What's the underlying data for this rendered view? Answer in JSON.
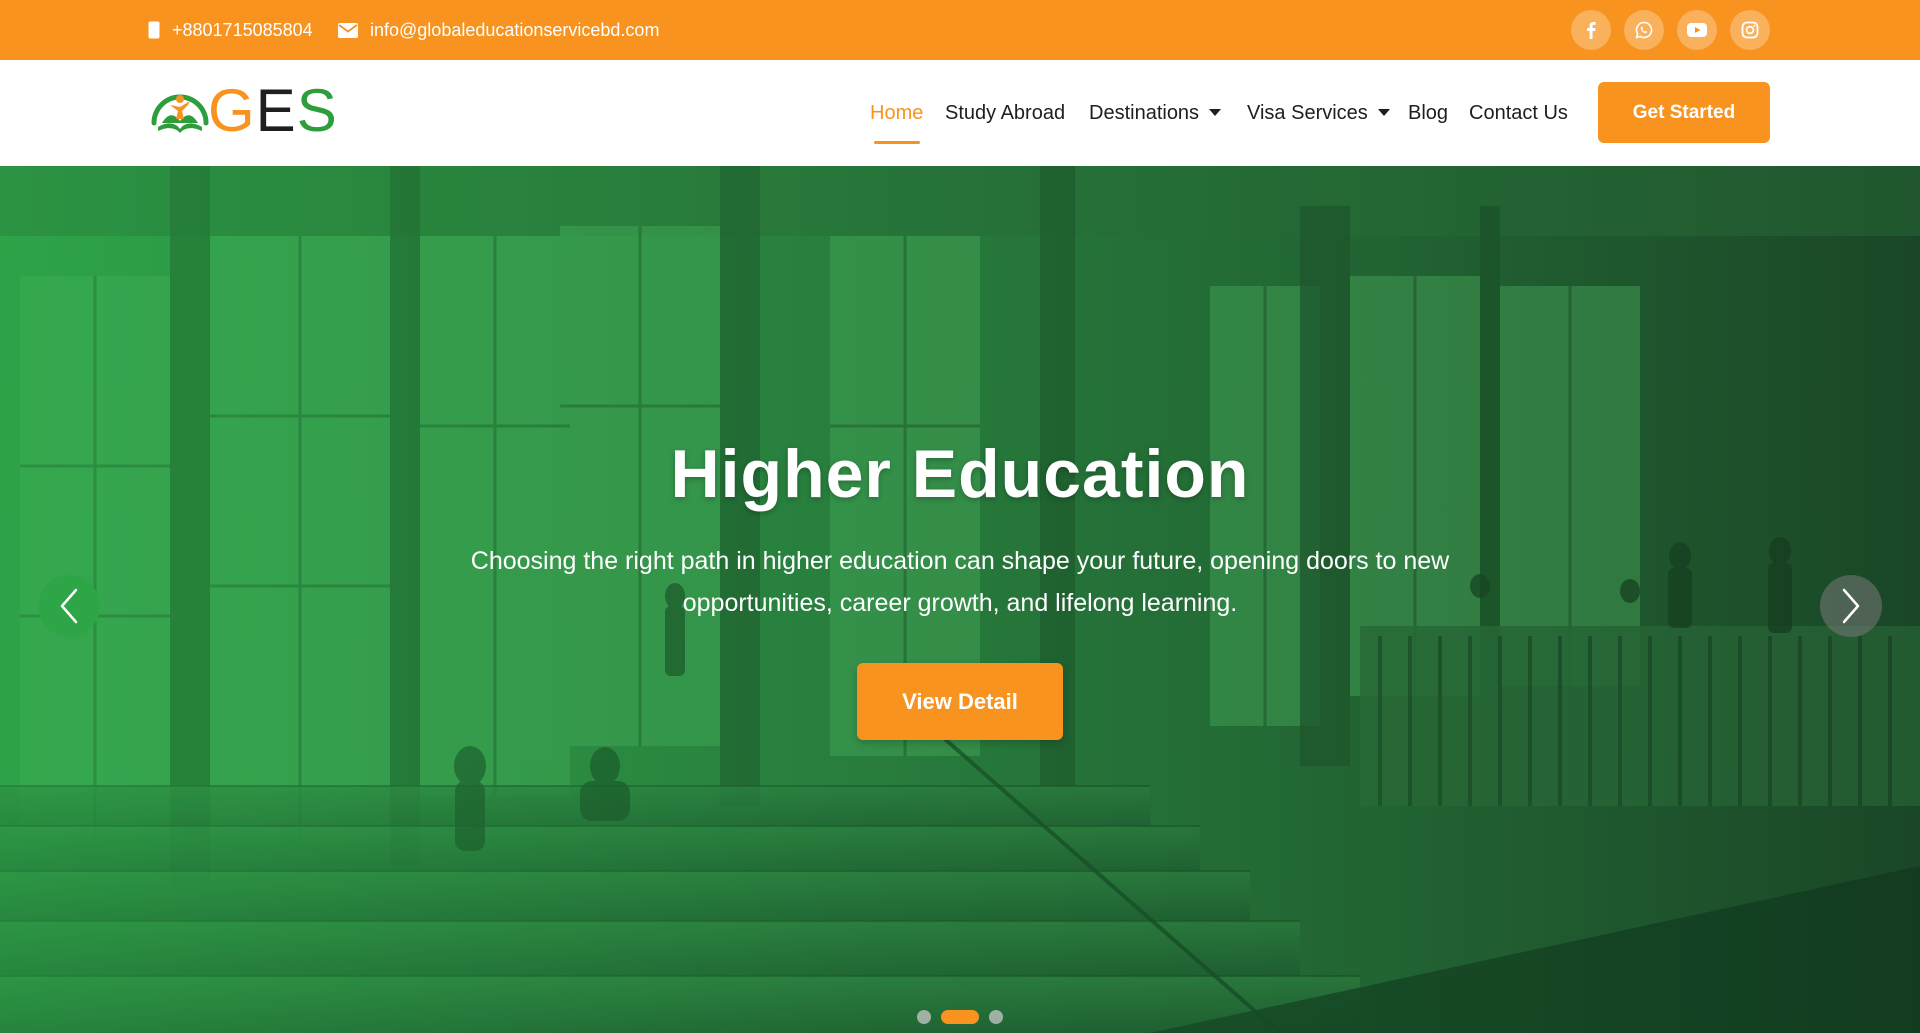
{
  "topbar": {
    "phone": "+8801715085804",
    "email": "info@globaleducationservicebd.com",
    "phone_icon": "mobile-phone-icon",
    "email_icon": "envelope-icon",
    "socials": [
      "facebook-icon",
      "whatsapp-icon",
      "youtube-icon",
      "instagram-icon"
    ]
  },
  "logo": {
    "letters": [
      "G",
      "E",
      "S"
    ]
  },
  "nav": {
    "items": [
      {
        "label": "Home",
        "active": true
      },
      {
        "label": "Study Abroad"
      },
      {
        "label": "Destinations",
        "dropdown": true
      },
      {
        "label": "Visa Services",
        "dropdown": true
      },
      {
        "label": "Blog"
      },
      {
        "label": "Contact Us"
      }
    ],
    "cta": "Get Started"
  },
  "hero": {
    "title": "Higher Education",
    "description": "Choosing the right path in higher education can shape your future, opening doors to new opportunities, career growth, and lifelong learning.",
    "button": "View Detail",
    "slide_count": 3,
    "active_slide": 2
  },
  "colors": {
    "accent": "#f7931e",
    "brand_green": "#2e9e3c",
    "text_dark": "#1e1e1e"
  }
}
